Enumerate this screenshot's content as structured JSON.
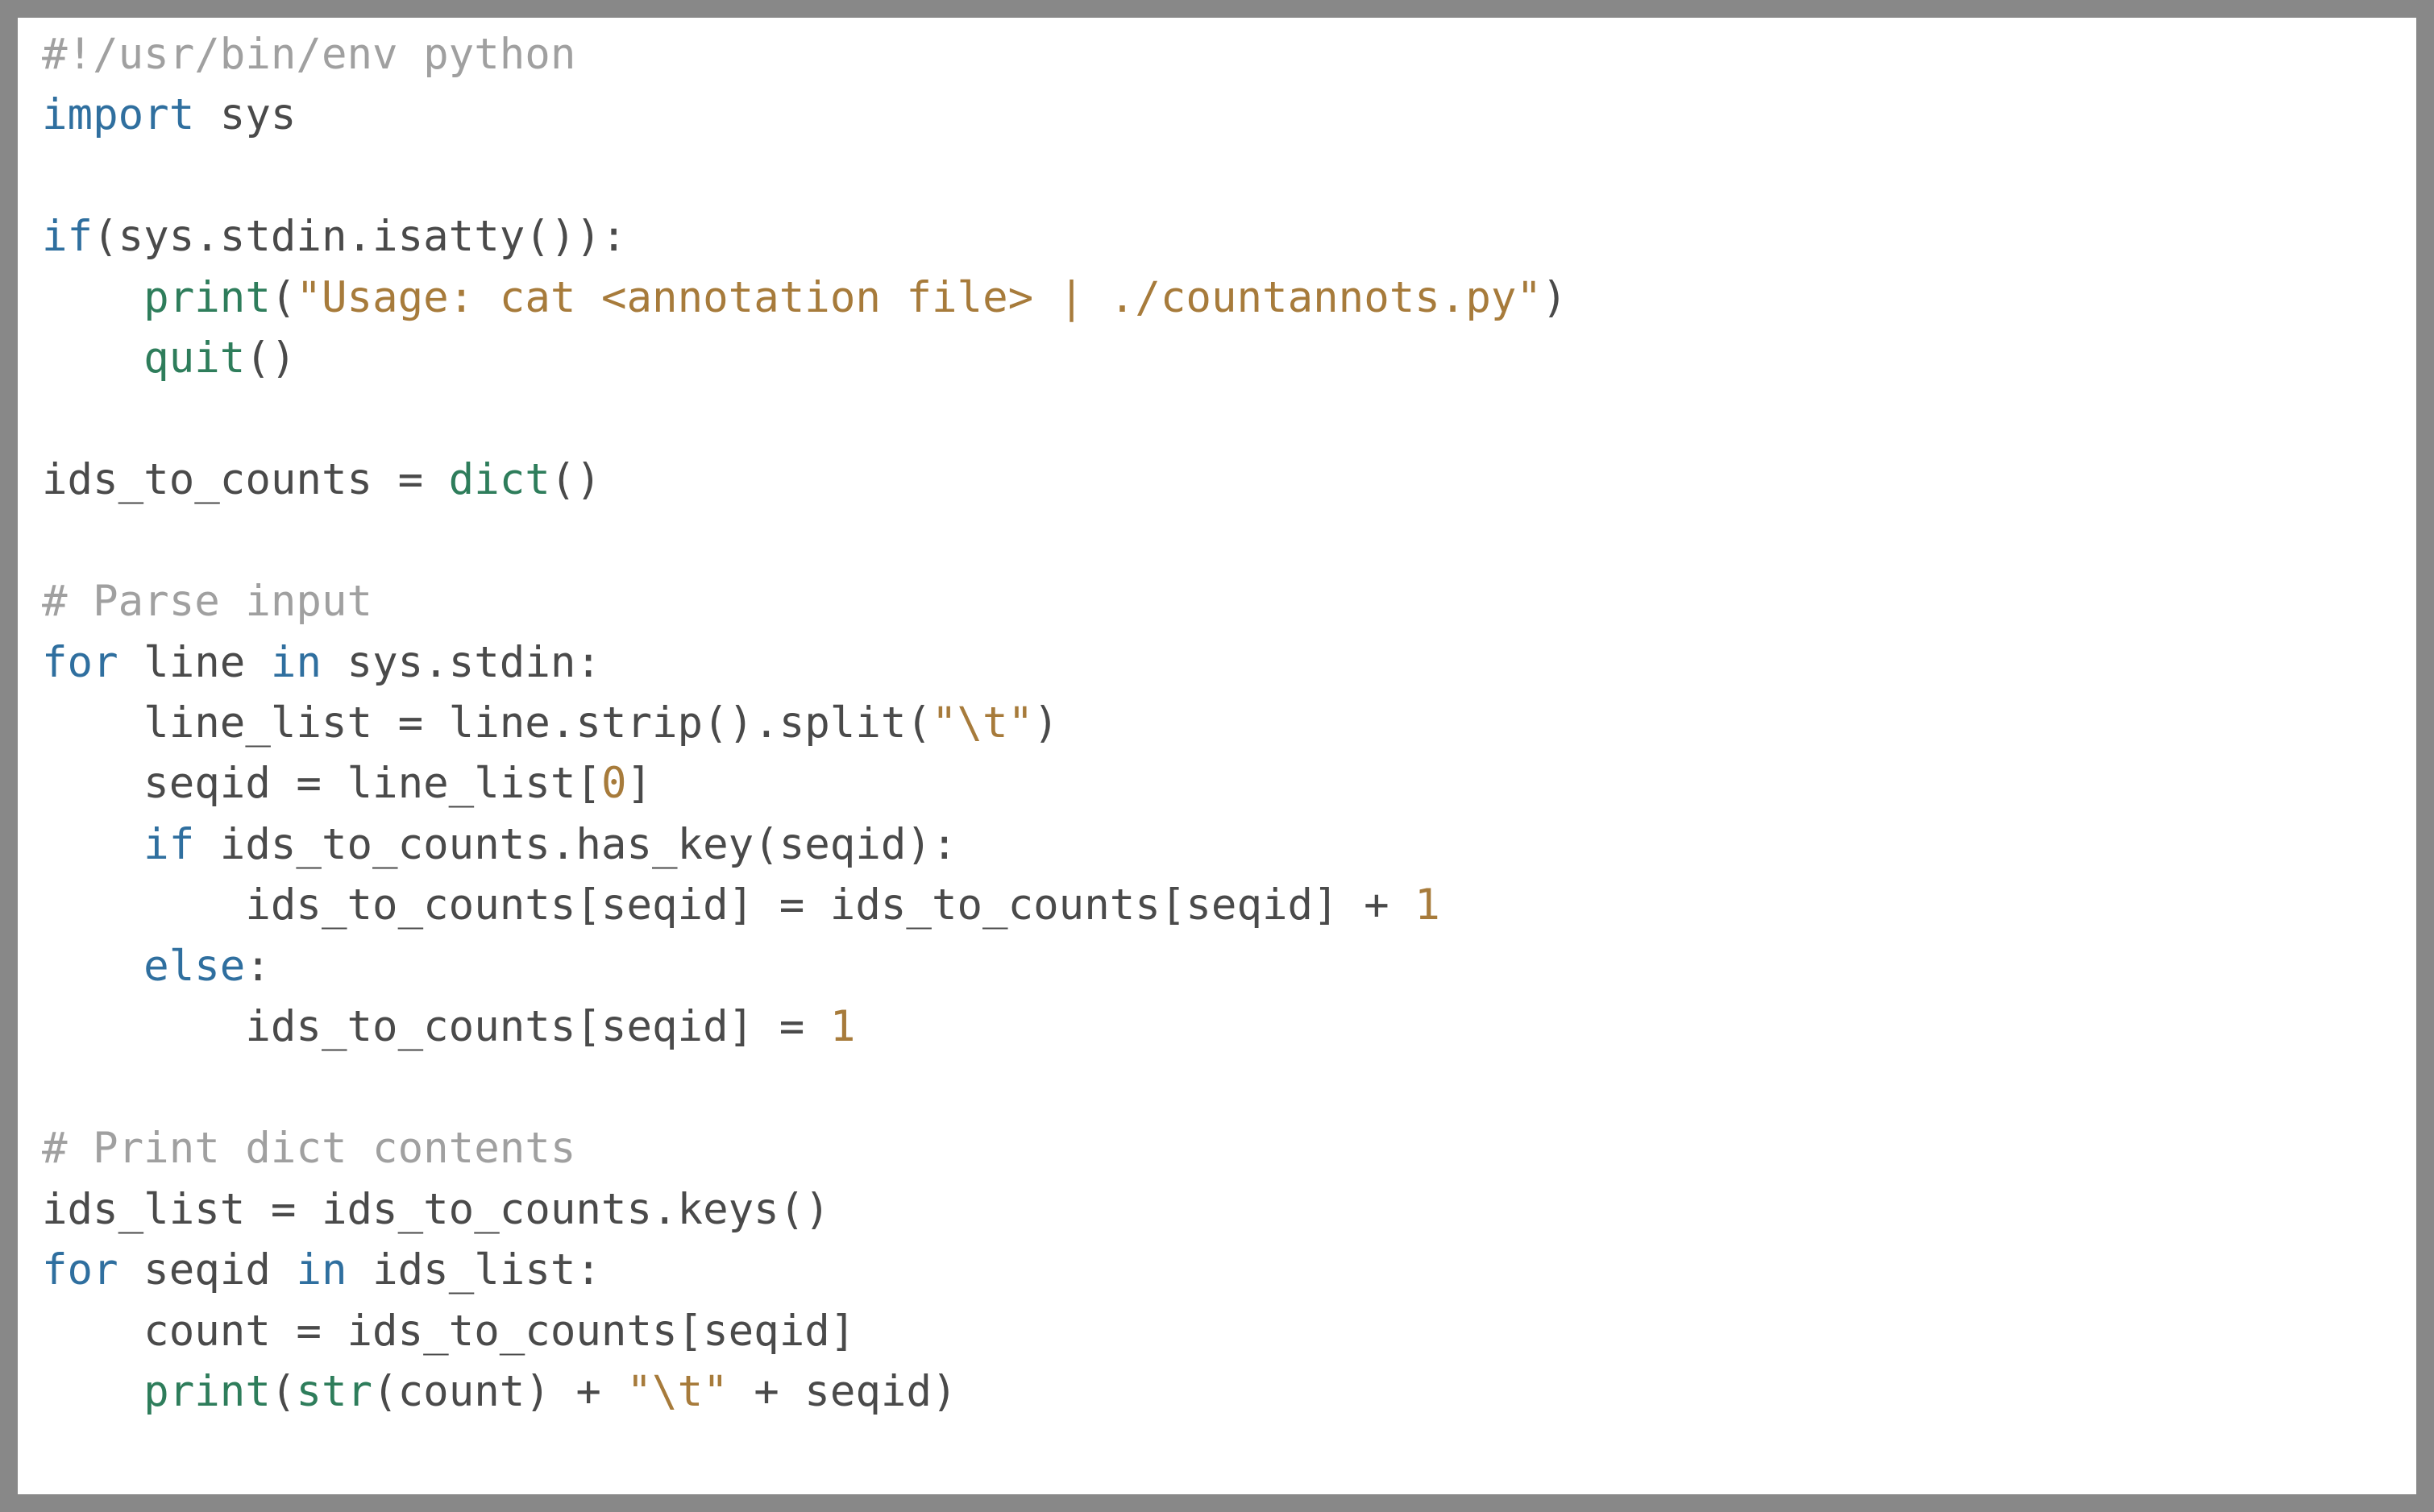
{
  "code": {
    "l01_shebang": "#!/usr/bin/env python",
    "l02_import": "import",
    "l02_sys": " sys",
    "l03": "",
    "l04a": "if",
    "l04b": "(sys.stdin.isatty()):",
    "l05_indent": "    ",
    "l05_print": "print",
    "l05_paren_open": "(",
    "l05_string": "\"Usage: cat <annotation file> | ./countannots.py\"",
    "l05_paren_close": ")",
    "l06_indent": "    ",
    "l06_quit": "quit",
    "l06_parens": "()",
    "l07": "",
    "l08a": "ids_to_counts = ",
    "l08_dict": "dict",
    "l08b": "()",
    "l09": "",
    "l10": "# Parse input",
    "l11_for": "for",
    "l11_line": " line ",
    "l11_in": "in",
    "l11_rest": " sys.stdin:",
    "l12_indent": "    ",
    "l12_text": "line_list = line.strip().split(",
    "l12_str": "\"\\t\"",
    "l12_close": ")",
    "l13_indent": "    ",
    "l13_text": "seqid = line_list[",
    "l13_num": "0",
    "l13_close": "]",
    "l14_indent": "    ",
    "l14_if": "if",
    "l14_rest": " ids_to_counts.has_key(seqid):",
    "l15_indent": "        ",
    "l15_text": "ids_to_counts[seqid] = ids_to_counts[seqid] + ",
    "l15_num": "1",
    "l16_indent": "    ",
    "l16_else": "else",
    "l16_colon": ":",
    "l17_indent": "        ",
    "l17_text": "ids_to_counts[seqid] = ",
    "l17_num": "1",
    "l18": "",
    "l19": "# Print dict contents",
    "l20": "ids_list = ids_to_counts.keys()",
    "l21_for": "for",
    "l21_seqid": " seqid ",
    "l21_in": "in",
    "l21_rest": " ids_list:",
    "l22_indent": "    ",
    "l22_text": "count = ids_to_counts[seqid]",
    "l23_indent": "    ",
    "l23_print": "print",
    "l23_open": "(",
    "l23_str": "str",
    "l23_mid": "(count) + ",
    "l23_tab": "\"\\t\"",
    "l23_end": " + seqid)"
  }
}
